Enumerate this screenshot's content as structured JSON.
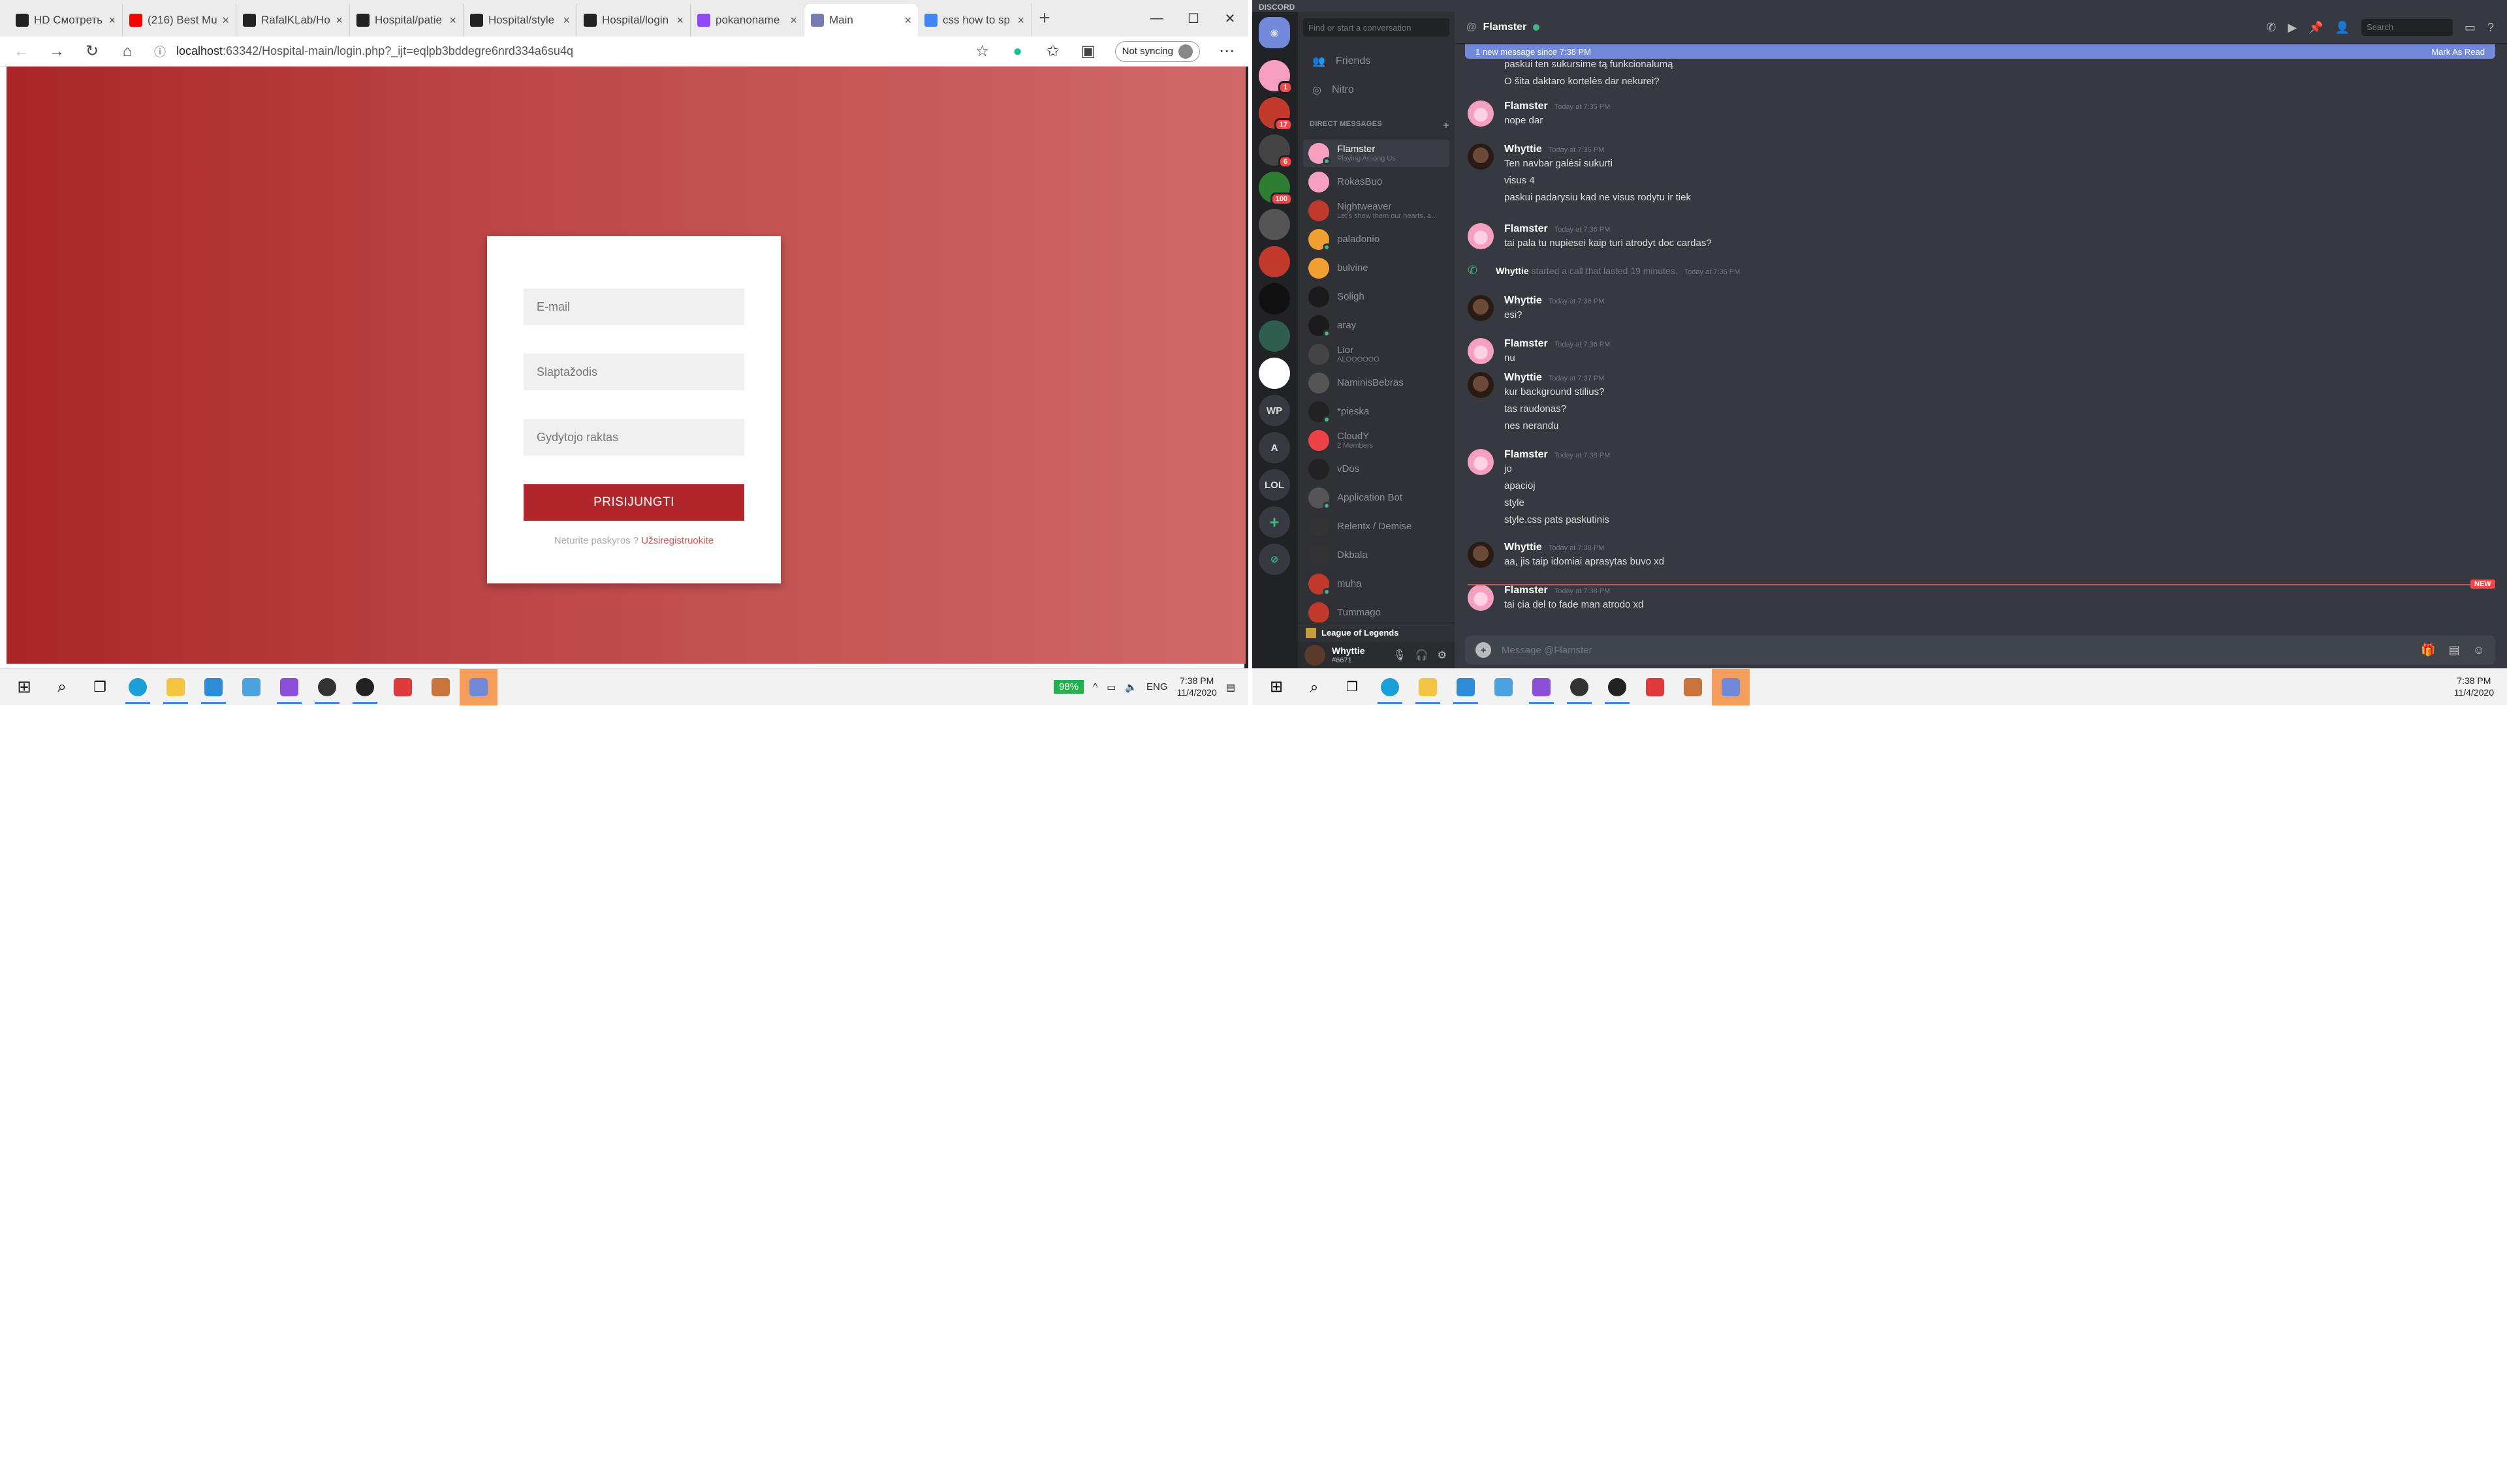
{
  "browser": {
    "tabs": [
      {
        "label": "HD Смотреть фи",
        "icon": "hd-favicon-icon",
        "color": "#222"
      },
      {
        "label": "(216) Best Mu",
        "icon": "youtube-icon",
        "color": "#ff0000"
      },
      {
        "label": "RafalKLab/Ho",
        "icon": "github-icon",
        "color": "#222"
      },
      {
        "label": "Hospital/patie",
        "icon": "github-icon",
        "color": "#222"
      },
      {
        "label": "Hospital/style",
        "icon": "github-icon",
        "color": "#222"
      },
      {
        "label": "Hospital/login",
        "icon": "github-icon",
        "color": "#222"
      },
      {
        "label": "pokanoname",
        "icon": "twitch-icon",
        "color": "#9146ff"
      },
      {
        "label": "Main",
        "icon": "php-icon",
        "color": "#777bb3",
        "active": true
      },
      {
        "label": "css how to sp",
        "icon": "google-icon",
        "color": "#4285f4"
      }
    ],
    "url_host": "localhost",
    "url_rest": ":63342/Hospital-main/login.php?_ijt=eqlpb3bddegre6nrd334a6su4q",
    "sync_label": "Not syncing",
    "login": {
      "email_placeholder": "E-mail",
      "password_placeholder": "Slaptažodis",
      "key_placeholder": "Gydytojo raktas",
      "submit_label": "PRISIJUNGTI",
      "no_account": "Neturite paskyros ? ",
      "register_link": "Užsiregistruokite"
    }
  },
  "taskbar": {
    "battery": "98%",
    "lang": "ENG",
    "time": "7:38 PM",
    "date": "11/4/2020"
  },
  "discord": {
    "app_title": "DISCORD",
    "search_placeholder": "Find or start a conversation",
    "nav": [
      {
        "label": "Friends",
        "icon": "friends-icon"
      },
      {
        "label": "Nitro",
        "icon": "nitro-icon"
      }
    ],
    "dm_header": "DIRECT MESSAGES",
    "guild_labels": [
      "WP",
      "A",
      "LOL"
    ],
    "guild_badges": [
      "1",
      "17",
      "6",
      "100"
    ],
    "dms": [
      {
        "name": "Flamster",
        "sub": "Playing Among Us",
        "color": "#f5a0c0",
        "selected": true
      },
      {
        "name": "RokasBuo",
        "sub": "",
        "color": "#f5a0c0"
      },
      {
        "name": "Nightweaver",
        "sub": "Let's show them our hearts, a...",
        "color": "#c0392b"
      },
      {
        "name": "paladonio",
        "sub": "",
        "color": "#f0a030"
      },
      {
        "name": "bulvine",
        "sub": "",
        "color": "#f0a030"
      },
      {
        "name": "Soligh",
        "sub": "",
        "color": "#1a1a1a"
      },
      {
        "name": "aray",
        "sub": "",
        "color": "#1a1a1a"
      },
      {
        "name": "Lior",
        "sub": "ALOOOOOO",
        "color": "#444"
      },
      {
        "name": "NaminisBebras",
        "sub": "",
        "color": "#555"
      },
      {
        "name": "*pieska",
        "sub": "",
        "color": "#222"
      },
      {
        "name": "CloudY",
        "sub": "2 Members",
        "color": "#ed4245"
      },
      {
        "name": "vDos",
        "sub": "",
        "color": "#222"
      },
      {
        "name": "Application Bot",
        "sub": "",
        "color": "#555"
      },
      {
        "name": "Relentx / Demise",
        "sub": "",
        "color": "#333"
      },
      {
        "name": "Dkbala",
        "sub": "",
        "color": "#333"
      },
      {
        "name": "muha",
        "sub": "",
        "color": "#c0392b"
      },
      {
        "name": "Tummago",
        "sub": "",
        "color": "#c0392b"
      }
    ],
    "voice_channel": "League of Legends",
    "user": {
      "name": "Whyttie",
      "tag": "#6671"
    },
    "chat_title": "Flamster",
    "chat_search": "Search",
    "new_bar": "1 new message since 7:38 PM",
    "mark_read": "Mark As Read",
    "new_tag": "NEW",
    "composer_placeholder": "Message @Flamster",
    "messages": [
      {
        "author": "",
        "time": "",
        "lines": [
          "paskui ten sukursime tą funkcionalumą",
          "O šita daktaro kortelės dar nekurei?"
        ]
      },
      {
        "author": "Flamster",
        "time": "Today at 7:35 PM",
        "lines": [
          "nope dar"
        ]
      },
      {
        "author": "Whyttie",
        "time": "Today at 7:35 PM",
        "lines": [
          "Ten navbar galėsi sukurti",
          "visus 4",
          "paskui padarysiu kad ne visus  rodytu ir tiek"
        ]
      },
      {
        "author": "Flamster",
        "time": "Today at 7:36 PM",
        "lines": [
          "tai pala tu nupiesei kaip turi atrodyt doc cardas?"
        ]
      },
      {
        "author": "Whyttie",
        "time": "Today at 7:36 PM",
        "system": "started a call that lasted 19 minutes."
      },
      {
        "author": "Whyttie",
        "time": "Today at 7:36 PM",
        "lines": [
          "esi?"
        ]
      },
      {
        "author": "Flamster",
        "time": "Today at 7:36 PM",
        "lines": [
          "nu"
        ]
      },
      {
        "author": "Whyttie",
        "time": "Today at 7:37 PM",
        "lines": [
          "kur background stilius?",
          "tas raudonas?",
          "nes nerandu"
        ]
      },
      {
        "author": "Flamster",
        "time": "Today at 7:38 PM",
        "lines": [
          "jo",
          "apacioj",
          "style",
          "style.css pats paskutinis"
        ]
      },
      {
        "author": "Whyttie",
        "time": "Today at 7:38 PM",
        "lines": [
          "aa, jis taip idomiai aprasytas buvo xd"
        ]
      },
      {
        "author": "Flamster",
        "time": "Today at 7:38 PM",
        "lines": [
          "tai cia del to fade man atrodo xd"
        ]
      }
    ]
  }
}
